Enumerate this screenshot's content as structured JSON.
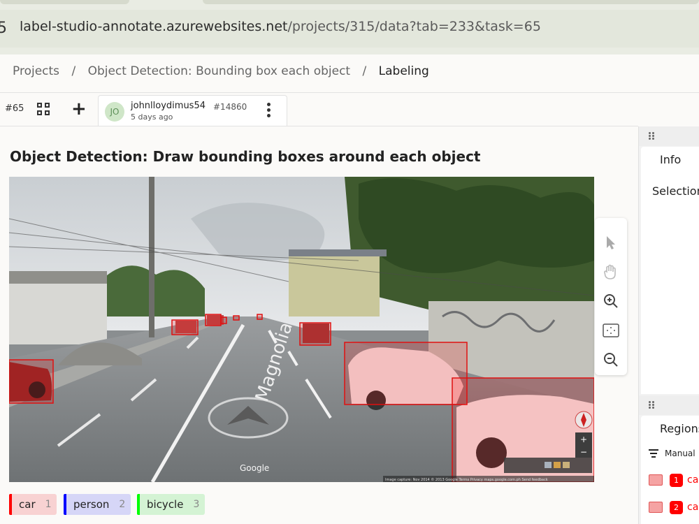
{
  "browser": {
    "url_host": "label-studio-annotate.azurewebsites.net",
    "url_path": "/projects/315/data?tab=233&task=65",
    "leading_glyph": "5"
  },
  "breadcrumb": {
    "items": [
      "Projects",
      "Object Detection: Bounding box each object",
      "Labeling"
    ],
    "separator": "/"
  },
  "toolbar": {
    "task_id": "#65",
    "grid_icon": "grid-icon",
    "add_icon": "plus-icon",
    "annotation": {
      "avatar_initials": "JO",
      "user": "johnlloydimus54",
      "annotation_id": "#14860",
      "time": "5 days ago"
    }
  },
  "task": {
    "title": "Object Detection: Draw bounding boxes around each object",
    "street_text": "Magnolia",
    "watermark": "Google",
    "capture_footer": "Image capture: Nov 2014   © 2013 Google   Terms   Privacy   maps.google.com.ph   Send feedback"
  },
  "tools": [
    "pointer-icon",
    "hand-icon",
    "zoom-in-icon",
    "fit-icon",
    "zoom-out-icon"
  ],
  "labels": [
    {
      "name": "car",
      "hotkey": "1",
      "color": "#ff0000",
      "bg": "#f8d2d2"
    },
    {
      "name": "person",
      "hotkey": "2",
      "color": "#0000ff",
      "bg": "#d6d6f7"
    },
    {
      "name": "bicycle",
      "hotkey": "3",
      "color": "#00ff00",
      "bg": "#d4f3d4"
    }
  ],
  "side_panel": {
    "info_tab": "Info",
    "selection_text": "Selection",
    "regions_tab": "Regions",
    "manual_label": "Manual",
    "regions": [
      {
        "index": "1",
        "label": "ca"
      },
      {
        "index": "2",
        "label": "ca"
      }
    ]
  },
  "colors": {
    "region_stroke": "#e01010",
    "region_fill": "rgba(255,0,0,0.18)"
  }
}
